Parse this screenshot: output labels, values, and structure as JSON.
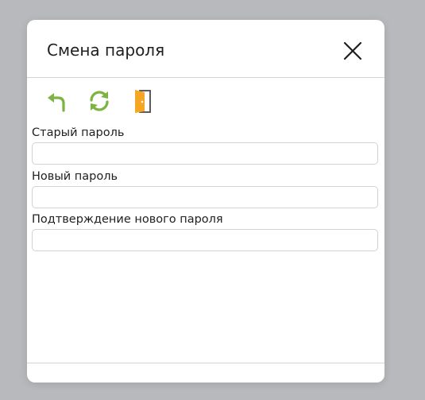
{
  "dialog": {
    "title": "Смена пароля",
    "close_icon": "close-icon"
  },
  "toolbar": {
    "undo_icon": "undo-arrow-icon",
    "refresh_icon": "refresh-icon",
    "exit_icon": "exit-door-icon",
    "accent_green": "#7cb342",
    "accent_orange": "#f5a623"
  },
  "form": {
    "old_password": {
      "label": "Старый пароль",
      "value": ""
    },
    "new_password": {
      "label": "Новый пароль",
      "value": ""
    },
    "confirm_password": {
      "label": "Подтверждение нового пароля",
      "value": ""
    }
  }
}
